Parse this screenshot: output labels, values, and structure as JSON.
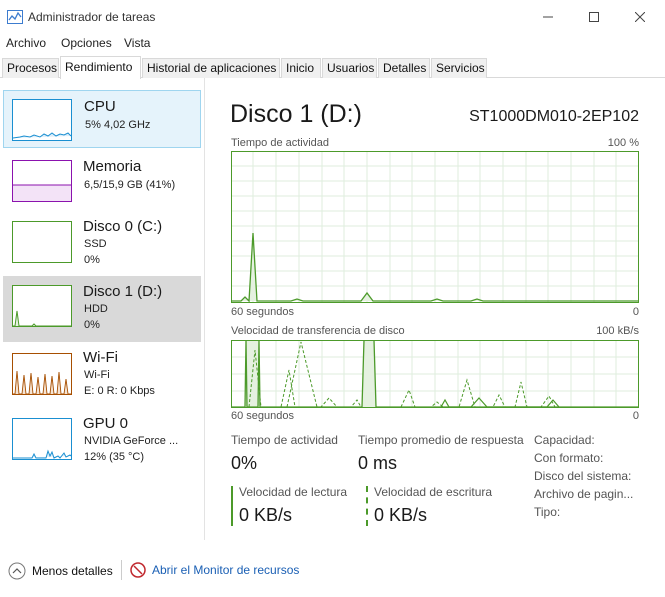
{
  "window": {
    "title": "Administrador de tareas"
  },
  "menu": [
    "Archivo",
    "Opciones",
    "Vista"
  ],
  "tabs": [
    "Procesos",
    "Rendimiento",
    "Historial de aplicaciones",
    "Inicio",
    "Usuarios",
    "Detalles",
    "Servicios"
  ],
  "active_tab": "Rendimiento",
  "sidebar": [
    {
      "title": "CPU",
      "lines": [
        "5%  4,02 GHz"
      ],
      "color": "#1a8fd1"
    },
    {
      "title": "Memoria",
      "lines": [
        "6,5/15,9 GB (41%)"
      ],
      "color": "#8b12ae"
    },
    {
      "title": "Disco 0 (C:)",
      "lines": [
        "SSD",
        "0%"
      ],
      "color": "#4c9a2a"
    },
    {
      "title": "Disco 1 (D:)",
      "lines": [
        "HDD",
        "0%"
      ],
      "color": "#4c9a2a"
    },
    {
      "title": "Wi-Fi",
      "lines": [
        "Wi-Fi",
        "E: 0  R: 0 Kbps"
      ],
      "color": "#a74f01"
    },
    {
      "title": "GPU 0",
      "lines": [
        "NVIDIA GeForce ...",
        "12%  (35 °C)"
      ],
      "color": "#1a8fd1"
    }
  ],
  "main": {
    "title": "Disco 1 (D:)",
    "model": "ST1000DM010-2EP102",
    "graph1": {
      "label": "Tiempo de actividad",
      "max": "100 %",
      "time": "60 segundos",
      "min": "0"
    },
    "graph2": {
      "label": "Velocidad de transferencia de disco",
      "max": "100 kB/s",
      "time": "60 segundos",
      "min": "0"
    },
    "stats": {
      "activity_label": "Tiempo de actividad",
      "activity_value": "0%",
      "response_label": "Tiempo promedio de respuesta",
      "response_value": "0 ms",
      "read_label": "Velocidad de lectura",
      "read_value": "0 KB/s",
      "write_label": "Velocidad de escritura",
      "write_value": "0 KB/s"
    },
    "info": [
      "Capacidad:",
      "Con formato:",
      "Disco del sistema:",
      "Archivo de pagin...",
      "Tipo:"
    ]
  },
  "bottom": {
    "fewer_details": "Menos detalles",
    "resource_monitor": "Abrir el Monitor de recursos"
  },
  "colors": {
    "disk_green": "#4c9a2a",
    "grid": "#dfeedd",
    "link": "#1a5fb4"
  }
}
